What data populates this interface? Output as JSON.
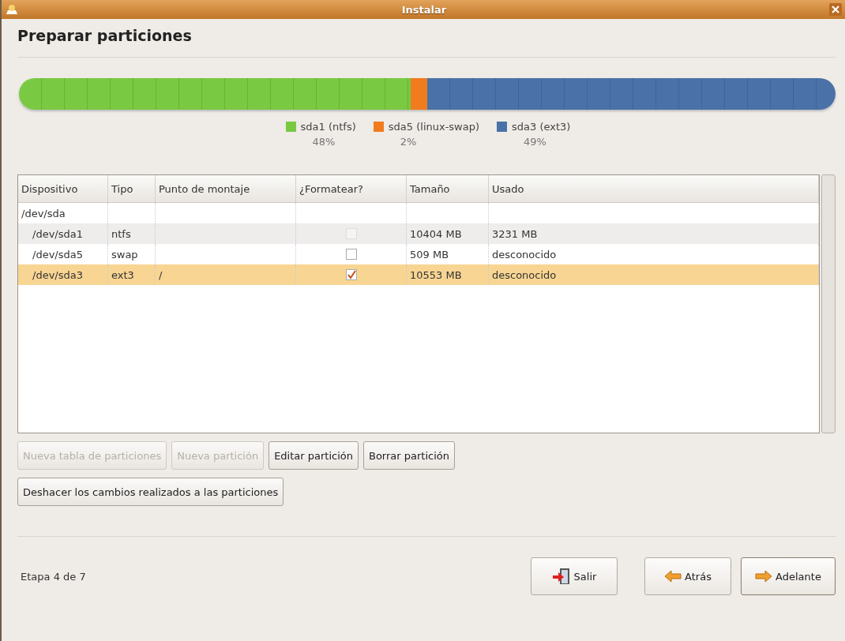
{
  "window": {
    "title": "Instalar"
  },
  "heading": "Preparar particiones",
  "partition_bar": [
    {
      "name": "sda1 (ntfs)",
      "percent": "48%",
      "level": 0.48,
      "color": "#7ac943"
    },
    {
      "name": "sda5 (linux-swap)",
      "percent": "2%",
      "level": 0.02,
      "color": "#f07c1e"
    },
    {
      "name": "sda3 (ext3)",
      "percent": "49%",
      "level": 0.5,
      "color": "#4a72a8"
    }
  ],
  "table": {
    "columns": [
      "Dispositivo",
      "Tipo",
      "Punto de montaje",
      "¿Formatear?",
      "Tamaño",
      "Usado"
    ],
    "rows": [
      {
        "device": "/dev/sda",
        "selected": false,
        "children": [
          {
            "device": "/dev/sda1",
            "type": "ntfs",
            "format": false,
            "format_disabled": true,
            "size": "10404 MB",
            "used": "3231 MB",
            "selected": false
          },
          {
            "device": "/dev/sda5",
            "type": "swap",
            "format": false,
            "format_disabled": false,
            "size": "509 MB",
            "used": "desconocido",
            "selected": false
          },
          {
            "device": "/dev/sda3",
            "type": "ext3",
            "mount": "/",
            "format": true,
            "format_disabled": false,
            "size": "10553 MB",
            "used": "desconocido",
            "selected": true
          }
        ]
      }
    ]
  },
  "partition_buttons": [
    {
      "label": "Nueva tabla de particiones",
      "disabled": true
    },
    {
      "label": "Nueva partición",
      "disabled": true
    },
    {
      "label": "Editar partición",
      "disabled": false
    },
    {
      "label": "Borrar partición",
      "disabled": false
    }
  ],
  "undo_button": "Deshacer los cambios realizados a las particiones",
  "status_bar": {
    "step": "Etapa 4 de 7"
  },
  "nav_buttons": [
    {
      "kind": "quit",
      "label": "Salir",
      "focused": false
    },
    {
      "kind": "back",
      "label": "Atrás",
      "focused": false
    },
    {
      "kind": "forward",
      "label": "Adelante",
      "focused": true
    }
  ]
}
